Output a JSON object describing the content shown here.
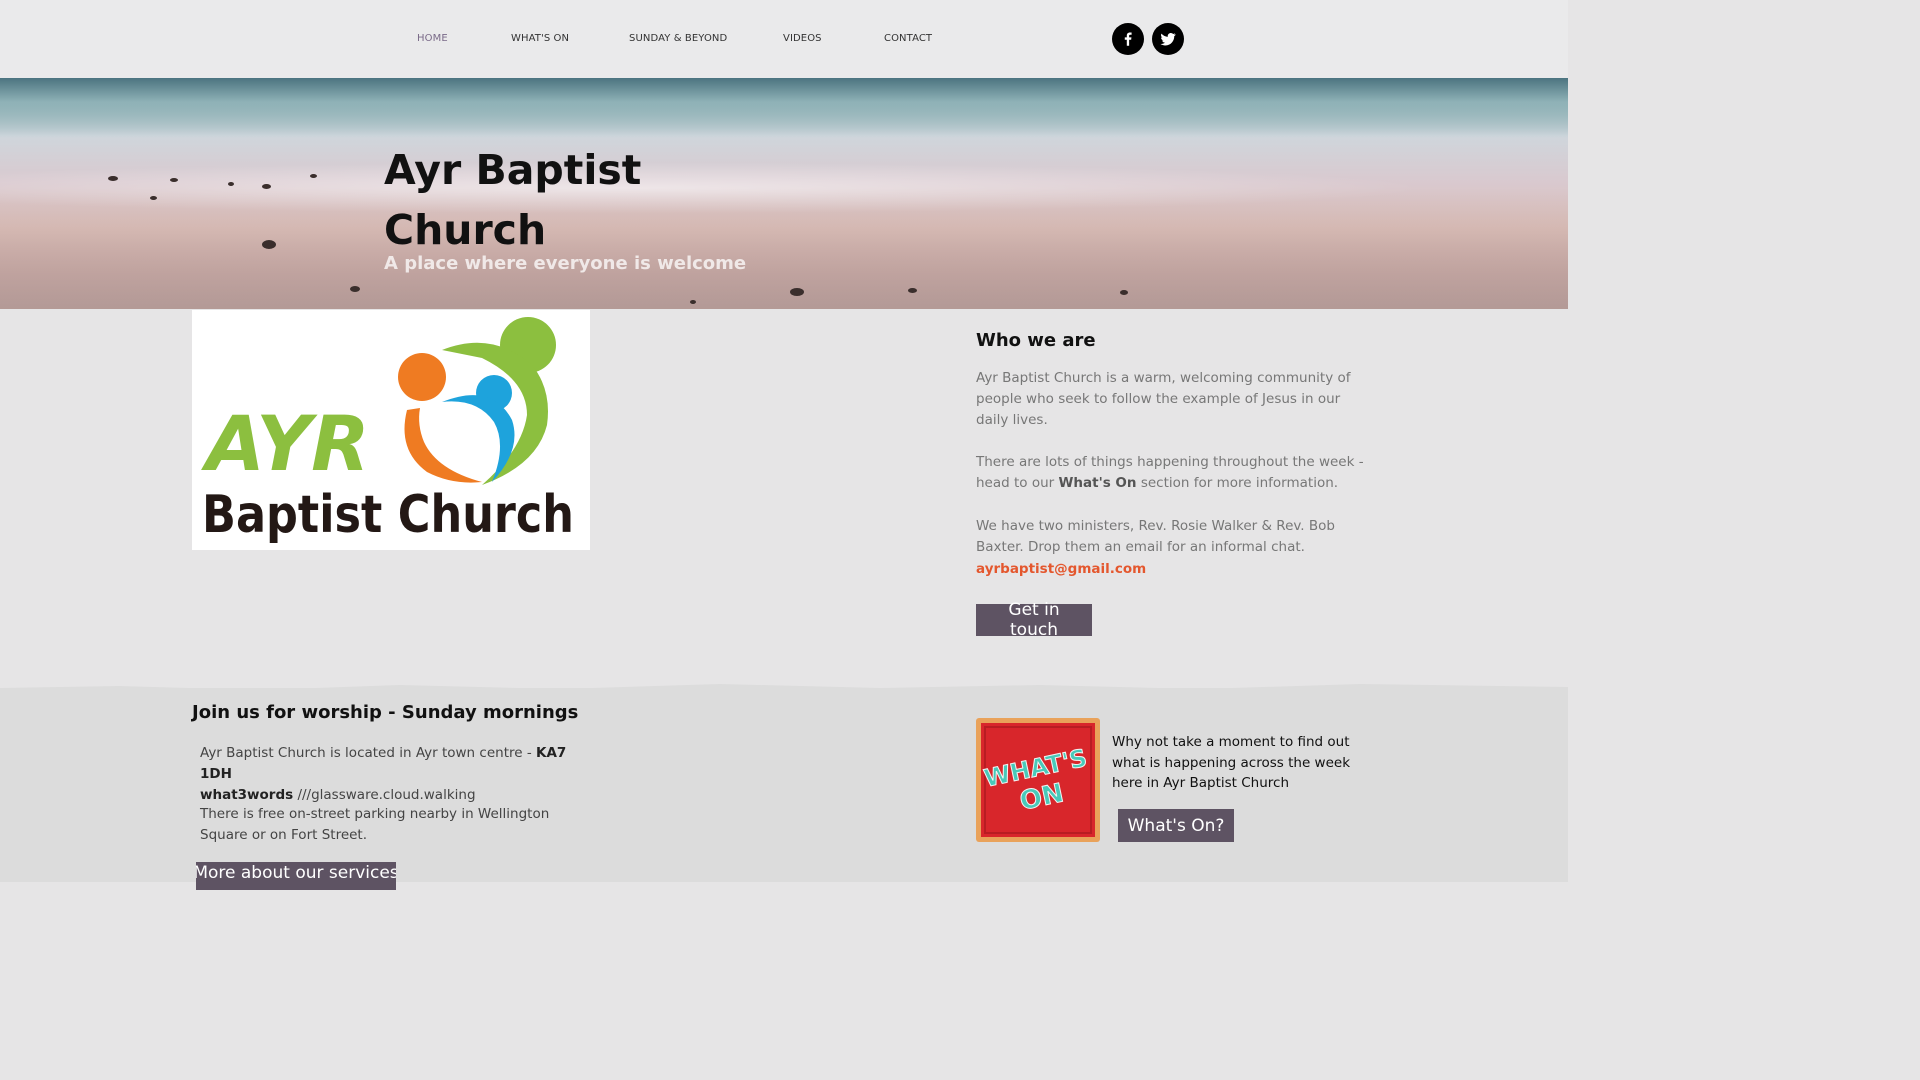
{
  "nav": {
    "items": [
      "HOME",
      "WHAT'S ON",
      "SUNDAY & BEYOND",
      "VIDEOS",
      "CONTACT"
    ],
    "active": "HOME"
  },
  "social": [
    "facebook-icon",
    "twitter-icon"
  ],
  "hero": {
    "title_line1": "Ayr Baptist",
    "title_line2": "Church",
    "subtitle": "A place where everyone is welcome"
  },
  "logo": {
    "line1": "AYR",
    "line2": "Baptist Church"
  },
  "who": {
    "heading": "Who we are",
    "para1": "Ayr Baptist Church is a warm, welcoming community of people who seek to follow the example of Jesus in our daily lives.",
    "para2_pre": "There are lots of things happening throughout the week - head to our ",
    "para2_bold": "What's On",
    "para2_post": " section for more information.",
    "para3": "We have two ministers, Rev. Rosie Walker & Rev. Bob Baxter. Drop them an email for an informal chat.",
    "email": "ayrbaptist@gmail.com",
    "button": "Get in touch"
  },
  "worship": {
    "heading": "Join us for worship - Sunday mornings",
    "loc_pre": "Ayr Baptist Church is located in Ayr town centre - ",
    "postcode": "KA7 1DH",
    "w3w_label": "what3words",
    "w3w_value": " ///glassware.cloud.walking",
    "parking": "There is free on-street parking nearby in Wellington Square or on Fort Street.",
    "button": "More about our services"
  },
  "whatson": {
    "image_line1": "WHAT'S",
    "image_line2": "ON",
    "text": "Why not take a moment to find out what is happening across the week here in Ayr Baptist Church",
    "button": "What's On?"
  },
  "colors": {
    "button_bg": "#5e5363",
    "email": "#e4572e",
    "logo_green": "#8cbf3f",
    "logo_orange": "#ef7b22",
    "logo_blue": "#1ea3dc",
    "whatson_red": "#d8262b"
  }
}
